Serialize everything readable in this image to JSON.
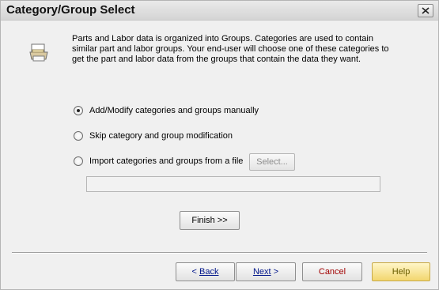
{
  "window": {
    "title": "Category/Group Select",
    "close_icon": "close-icon"
  },
  "intro": {
    "icon": "printer-icon",
    "text": "Parts and Labor data is organized into Groups.  Categories are used to contain\nsimilar part and labor groups.  Your end-user will choose one of these categories to\nget the part and labor data from the groups that contain the data they want."
  },
  "options": [
    {
      "label": "Add/Modify categories and groups manually",
      "checked": true
    },
    {
      "label": "Skip category and group modification",
      "checked": false
    },
    {
      "label": "Import categories and groups from a file",
      "checked": false
    }
  ],
  "import": {
    "select_label": "Select...",
    "file_value": ""
  },
  "buttons": {
    "finish": "Finish >>",
    "back_prefix": "< ",
    "back_text": "Back",
    "next_text": "Next",
    "next_suffix": " >",
    "cancel": "Cancel",
    "help": "Help"
  },
  "colors": {
    "help_accent": "#f2d66f"
  }
}
